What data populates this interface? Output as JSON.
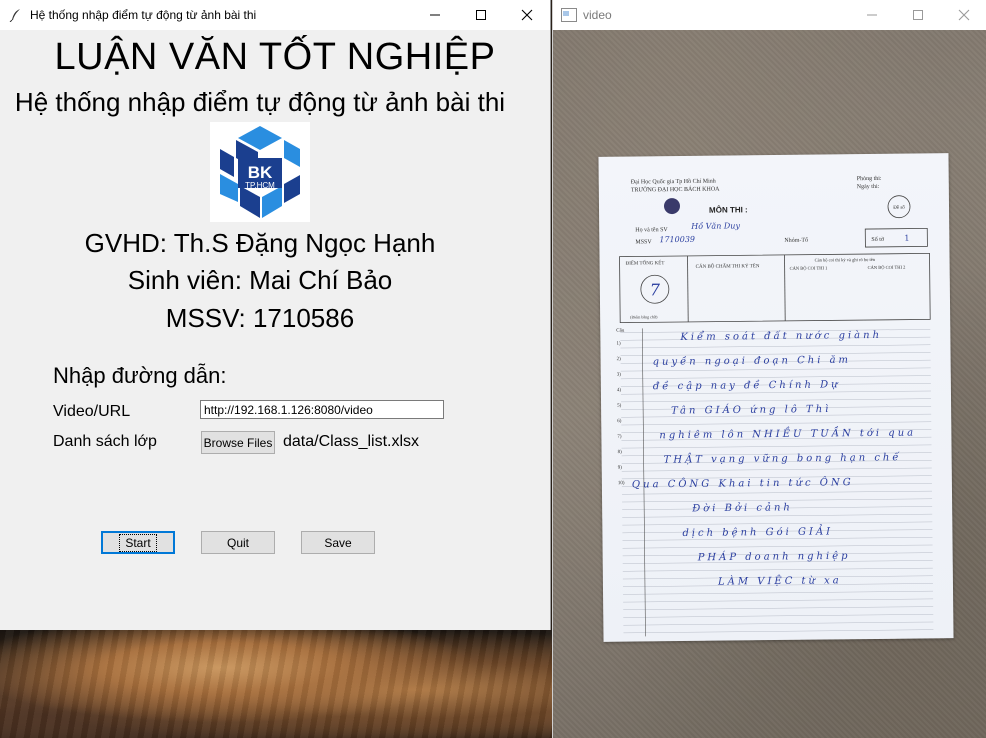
{
  "tk_window": {
    "title": "Hệ thống nhập điểm tự động từ ảnh bài thi",
    "heading": "LUẬN VĂN TỐT NGHIỆP",
    "subheading": "Hệ thống nhập điểm tự động từ ảnh bài thi",
    "logo": {
      "main": "BK",
      "sub": "TP.HCM"
    },
    "advisor": "GVHD: Th.S Đặng Ngọc Hạnh",
    "student": "Sinh viên: Mai Chí Bảo",
    "student_id": "MSSV: 1710586",
    "input_section_label": "Nhập đường dẫn:",
    "video_url_label": "Video/URL",
    "video_url_value": "http://192.168.1.126:8080/video",
    "class_list_label": "Danh sách lớp",
    "browse_button": "Browse Files",
    "class_list_path": "data/Class_list.xlsx",
    "start_button": "Start",
    "quit_button": "Quit",
    "save_button": "Save"
  },
  "video_window": {
    "title": "video",
    "paper": {
      "university": "Đại Học Quốc gia Tp Hồ Chí Minh",
      "school": "TRƯỜNG ĐẠI HỌC BÁCH KHOA",
      "exam_label": "MÔN THI :",
      "room_label": "Phòng thi:",
      "date_label": "Ngày thi:",
      "code_label": "Đề số",
      "name_label": "Họ và tên SV",
      "name_value": "Hồ Văn Duy",
      "mssv_label": "MSSV",
      "mssv_value": "1710039",
      "group_label": "Nhóm-Tổ",
      "sheet_label": "Số tờ",
      "sheet_value": "1",
      "total_score_label": "ĐIỂM TỔNG KẾT",
      "score_value": "7",
      "grader_label": "CÁN BỘ CHẤM THI KÝ TÊN",
      "invigilator_label": "Cán bộ coi thi ký và ghi rõ họ tên",
      "invigilator1": "CÁN BỘ COI THI 1",
      "invigilator2": "CÁN BỘ COI THI 2",
      "score_words_label": "(Điểm bằng chữ)",
      "question_col": "Câu",
      "question_numbers": [
        "1)",
        "2)",
        "3)",
        "4)",
        "5)",
        "6)",
        "7)",
        "8)",
        "9)",
        "10)"
      ],
      "handwriting_lines": [
        "Kiểm soát đất nước giành",
        "quyền ngoại đoạn Chi ăm",
        "đề cập nay đề Chính Dự",
        "Tân GIÁO ứng lô Thì",
        "nghiêm lôn NHIỀU TUẦN tới qua",
        "THẬT vạng vững bong hạn chế",
        "Qua CÔNG Khai tin tức ÔNG",
        "Đời Bởi cảnh",
        "dịch bệnh Gói GIẢI",
        "PHÁP doanh nghiệp",
        "LÀM VIỆC từ xa"
      ]
    }
  },
  "colors": {
    "logo_dark_blue": "#1b3f8f",
    "logo_light_blue": "#2a8ee0",
    "focus_blue": "#0078d7",
    "handwriting_blue": "#2b3fa0"
  }
}
